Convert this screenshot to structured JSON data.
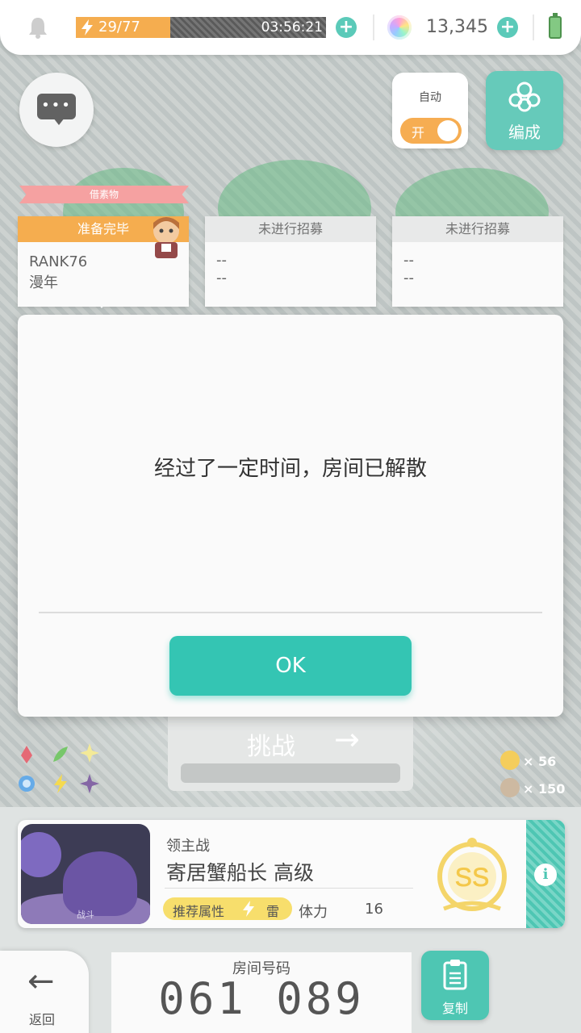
{
  "status_bar": {
    "stamina": "29/77",
    "stamina_fraction": 0.377,
    "timer": "03:56:21",
    "gems": "13,345"
  },
  "controls": {
    "auto_label": "自动",
    "auto_toggle": "开",
    "formation_label": "编成"
  },
  "recruit": {
    "ribbon": "借素物",
    "slots": [
      {
        "head": "准备完毕",
        "line1": "RANK76",
        "line2": "漫年"
      },
      {
        "head": "未进行招募",
        "line1": "--",
        "line2": "--"
      },
      {
        "head": "未进行招募",
        "line1": "--",
        "line2": "--"
      }
    ]
  },
  "challenge": {
    "label": "挑战",
    "costs": [
      {
        "amount": "× 56"
      },
      {
        "amount": "× 150"
      }
    ]
  },
  "boss": {
    "type": "领主战",
    "name": "寄居蟹船长 高级",
    "image_caption": "战斗",
    "attr_label": "推荐属性",
    "attr_element": "雷",
    "stamina_label": "体力",
    "stamina_value": "16",
    "rank": "SS"
  },
  "room": {
    "label": "房间号码",
    "number": "061 089"
  },
  "bottom": {
    "back_label": "返回",
    "copy_label": "复制"
  },
  "dialog": {
    "message": "经过了一定时间，房间已解散",
    "ok_label": "OK"
  },
  "colors": {
    "accent": "#34c5b3",
    "stamina": "#f5a741",
    "attr": "#f7de6c"
  }
}
